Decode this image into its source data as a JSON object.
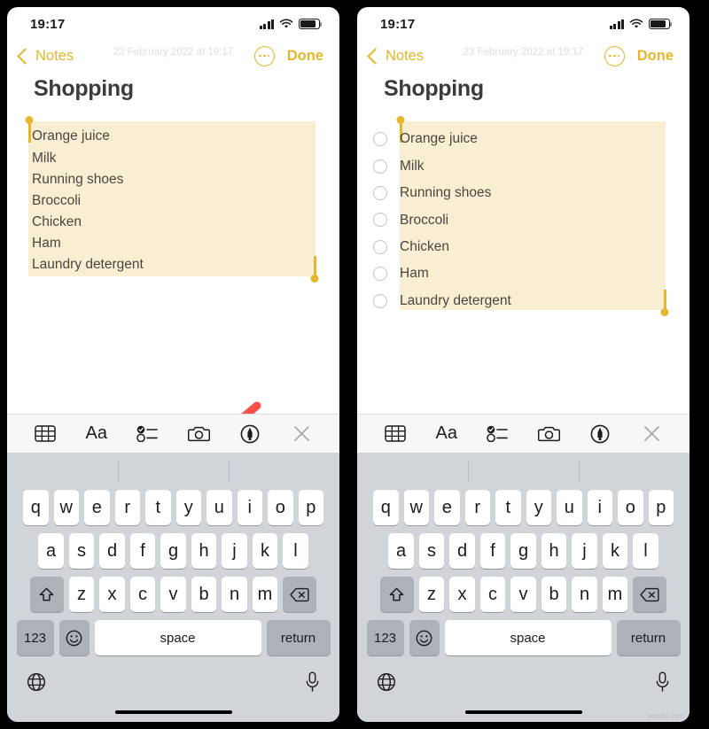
{
  "panels": [
    {
      "id": "before",
      "status": {
        "time": "19:17",
        "signal_icon": "cellular-bars-icon",
        "wifi_icon": "wifi-icon",
        "battery_icon": "battery-icon"
      },
      "nav": {
        "back_label": "Notes",
        "back_icon": "chevron-left-icon",
        "more_icon": "ellipsis-circle-icon",
        "done_label": "Done"
      },
      "note": {
        "datestamp": "23 February 2022 at 19:17",
        "title": "Shopping",
        "mode": "plain-text",
        "items": [
          "Orange juice",
          "Milk",
          "Running shoes",
          "Broccoli",
          "Chicken",
          "Ham",
          "Laundry detergent"
        ],
        "selection_active": true
      },
      "annotation": {
        "arrow": "red-arrow-pointing-to-checklist-button",
        "color": "#f8504a"
      }
    },
    {
      "id": "after",
      "status": {
        "time": "19:17",
        "signal_icon": "cellular-bars-icon",
        "wifi_icon": "wifi-icon",
        "battery_icon": "battery-icon"
      },
      "nav": {
        "back_label": "Notes",
        "back_icon": "chevron-left-icon",
        "more_icon": "ellipsis-circle-icon",
        "done_label": "Done"
      },
      "note": {
        "datestamp": "23 February 2022 at 19:17",
        "title": "Shopping",
        "mode": "checklist",
        "items": [
          "Orange juice",
          "Milk",
          "Running shoes",
          "Broccoli",
          "Chicken",
          "Ham",
          "Laundry detergent"
        ],
        "selection_active": true
      },
      "annotation": null
    }
  ],
  "toolbar": {
    "items": [
      {
        "name": "table-icon",
        "label": "Table"
      },
      {
        "name": "text-format-icon",
        "label": "Aa"
      },
      {
        "name": "checklist-icon",
        "label": "Checklist"
      },
      {
        "name": "camera-icon",
        "label": "Camera"
      },
      {
        "name": "markup-pen-icon",
        "label": "Markup"
      },
      {
        "name": "close-icon",
        "label": "Close"
      }
    ]
  },
  "keyboard": {
    "row1": [
      "q",
      "w",
      "e",
      "r",
      "t",
      "y",
      "u",
      "i",
      "o",
      "p"
    ],
    "row2": [
      "a",
      "s",
      "d",
      "f",
      "g",
      "h",
      "j",
      "k",
      "l"
    ],
    "row3": [
      "z",
      "x",
      "c",
      "v",
      "b",
      "n",
      "m"
    ],
    "shift_icon": "shift-arrow-icon",
    "backspace_icon": "backspace-icon",
    "numbers_label": "123",
    "emoji_icon": "emoji-smiley-icon",
    "space_label": "space",
    "return_label": "return",
    "globe_icon": "globe-icon",
    "mic_icon": "microphone-icon"
  },
  "colors": {
    "accent": "#e5b62e",
    "highlight": "#f8efd3",
    "arrow": "#f8504a",
    "keyboard_bg": "#d1d4d9",
    "toolbar_bg": "#f7f7f7",
    "text": "#4a4540"
  },
  "watermark": "wsxdn.com"
}
